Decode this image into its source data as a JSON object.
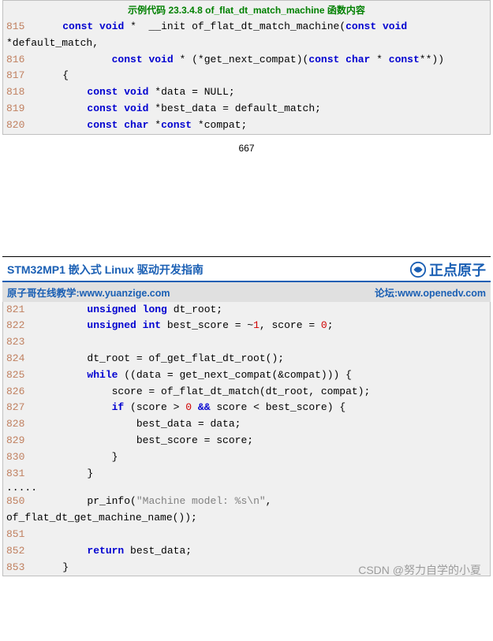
{
  "top_block": {
    "title": "示例代码 23.3.4.8 of_flat_dt_match_machine 函数内容",
    "lines": [
      {
        "no": "815",
        "html": "    <span class='kw'>const</span> <span class='kw'>void</span> <span class='id'>*  __init of_flat_dt_match_machine(</span><span class='kw'>const</span> <span class='kw'>void</span>"
      },
      {
        "no": "",
        "html": "<span class='id'>*default_match,</span>"
      },
      {
        "no": "816",
        "html": "            <span class='kw'>const</span> <span class='kw'>void</span> <span class='id'>* (*get_next_compat)(</span><span class='kw'>const</span> <span class='kw'>char</span> <span class='id'>* </span><span class='kw'>const</span><span class='id'>**))</span>"
      },
      {
        "no": "817",
        "html": "    <span class='id'>{</span>"
      },
      {
        "no": "818",
        "html": "        <span class='kw'>const</span> <span class='kw'>void</span> <span class='id'>*data = NULL;</span>"
      },
      {
        "no": "819",
        "html": "        <span class='kw'>const</span> <span class='kw'>void</span> <span class='id'>*best_data = default_match;</span>"
      },
      {
        "no": "820",
        "html": "        <span class='kw'>const</span> <span class='kw'>char</span> <span class='id'>*</span><span class='kw'>const</span> <span class='id'>*compat;</span>"
      }
    ]
  },
  "page_number": "667",
  "header": {
    "title": "STM32MP1 嵌入式 Linux 驱动开发指南",
    "brand": "正点原子",
    "row2_left_label": "原子哥在线教学:",
    "row2_left_url": "www.yuanzige.com",
    "row2_right_label": "论坛:",
    "row2_right_url": "www.openedv.com"
  },
  "bottom_block": {
    "lines": [
      {
        "no": "821",
        "html": "        <span class='kw'>unsigned</span> <span class='kw'>long</span> <span class='id'>dt_root;</span>"
      },
      {
        "no": "822",
        "html": "        <span class='kw'>unsigned</span> <span class='kw'>int</span> <span class='id'>best_score = ~</span><span class='num'>1</span><span class='id'>, score = </span><span class='num'>0</span><span class='id'>;</span>"
      },
      {
        "no": "823",
        "html": ""
      },
      {
        "no": "824",
        "html": "        <span class='id'>dt_root = of_get_flat_dt_root();</span>"
      },
      {
        "no": "825",
        "html": "        <span class='kw'>while</span> <span class='id'>((data = get_next_compat(&amp;compat))) {</span>"
      },
      {
        "no": "826",
        "html": "            <span class='id'>score = of_flat_dt_match(dt_root, compat);</span>"
      },
      {
        "no": "827",
        "html": "            <span class='kw'>if</span> <span class='id'>(score &gt; </span><span class='num'>0</span> <span class='kw'>&amp;&amp;</span> <span class='id'>score &lt; best_score) {</span>"
      },
      {
        "no": "828",
        "html": "                <span class='id'>best_data = data;</span>"
      },
      {
        "no": "829",
        "html": "                <span class='id'>best_score = score;</span>"
      },
      {
        "no": "830",
        "html": "            <span class='id'>}</span>"
      },
      {
        "no": "831",
        "html": "        <span class='id'>}</span>"
      }
    ],
    "dots": ".....",
    "lines2": [
      {
        "no": "850",
        "html": "        <span class='id'>pr_info(</span><span class='str'>\"Machine model: %s\\n\"</span><span class='id'>,</span>"
      },
      {
        "no": "",
        "html": "<span class='id'>of_flat_dt_get_machine_name());</span>"
      },
      {
        "no": "851",
        "html": ""
      },
      {
        "no": "852",
        "html": "        <span class='kw'>return</span> <span class='id'>best_data;</span>"
      },
      {
        "no": "853",
        "html": "    <span class='id'>}</span>"
      }
    ]
  },
  "watermark": "CSDN @努力自学的小夏"
}
